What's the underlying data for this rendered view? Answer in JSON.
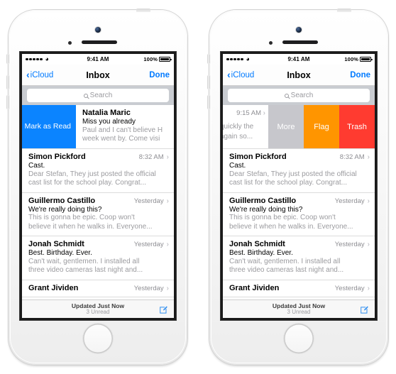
{
  "status_bar": {
    "signal_dots": 5,
    "wifi_icon": "wifi-icon",
    "time": "9:41 AM",
    "battery_percent": "100%"
  },
  "nav": {
    "back_label": "iCloud",
    "title": "Inbox",
    "done_label": "Done"
  },
  "search": {
    "placeholder": "Search",
    "icon": "search-icon"
  },
  "left_phone": {
    "swipe_row": {
      "action_label": "Mark as Read",
      "action_color": "#0b84ff",
      "sender": "Natalia Maric",
      "subject": "Miss you already",
      "preview_line1": "Paul and I can't believe H",
      "preview_line2": "week went by. Come visi"
    }
  },
  "right_phone": {
    "swipe_row": {
      "partial_time": "9:15 AM",
      "partial_preview_line1": "quickly the",
      "partial_preview_line2": "again so...",
      "actions": [
        {
          "label": "More",
          "color": "#c7c7cc"
        },
        {
          "label": "Flag",
          "color": "#ff9500"
        },
        {
          "label": "Trash",
          "color": "#ff3b30"
        }
      ]
    }
  },
  "messages": [
    {
      "sender": "Simon Pickford",
      "time": "8:32 AM",
      "subject": "Cast.",
      "preview_line1": "Dear Stefan, They just posted the official",
      "preview_line2": "cast list for the school play. Congrat..."
    },
    {
      "sender": "Guillermo Castillo",
      "time": "Yesterday",
      "subject": "We're really doing this?",
      "preview_line1": "This is gonna be epic. Coop won't",
      "preview_line2": "believe it when he walks in. Everyone..."
    },
    {
      "sender": "Jonah Schmidt",
      "time": "Yesterday",
      "subject": "Best. Birthday. Ever.",
      "preview_line1": "Can't wait, gentlemen. I installed all",
      "preview_line2": "three video cameras last night and..."
    },
    {
      "sender": "Grant Jividen",
      "time": "Yesterday",
      "subject": "",
      "preview_line1": "",
      "preview_line2": ""
    }
  ],
  "toolbar": {
    "updated_text": "Updated Just Now",
    "unread_text": "3 Unread",
    "compose_icon": "compose-icon"
  }
}
